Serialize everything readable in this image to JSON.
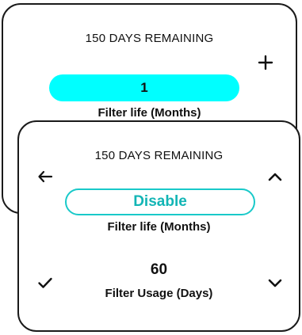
{
  "colors": {
    "accent": "#00ffff",
    "accent_outline": "#19c9c9",
    "accent_text": "#12b5b5",
    "border": "#1a1a1a",
    "text": "#111111",
    "background": "#ffffff"
  },
  "back_screen": {
    "days_remaining": "150 DAYS REMAINING",
    "plus_icon": "plus-icon",
    "filter_life_value": "1",
    "filter_life_label": "Filter life (Months)"
  },
  "front_screen": {
    "days_remaining": "150 DAYS REMAINING",
    "back_icon": "arrow-left-icon",
    "up_icon": "chevron-up-icon",
    "filter_life_value": "Disable",
    "filter_life_label": "Filter life (Months)",
    "filter_usage_value": "60",
    "filter_usage_label": "Filter Usage (Days)",
    "confirm_icon": "checkmark-icon",
    "down_icon": "chevron-down-icon"
  }
}
